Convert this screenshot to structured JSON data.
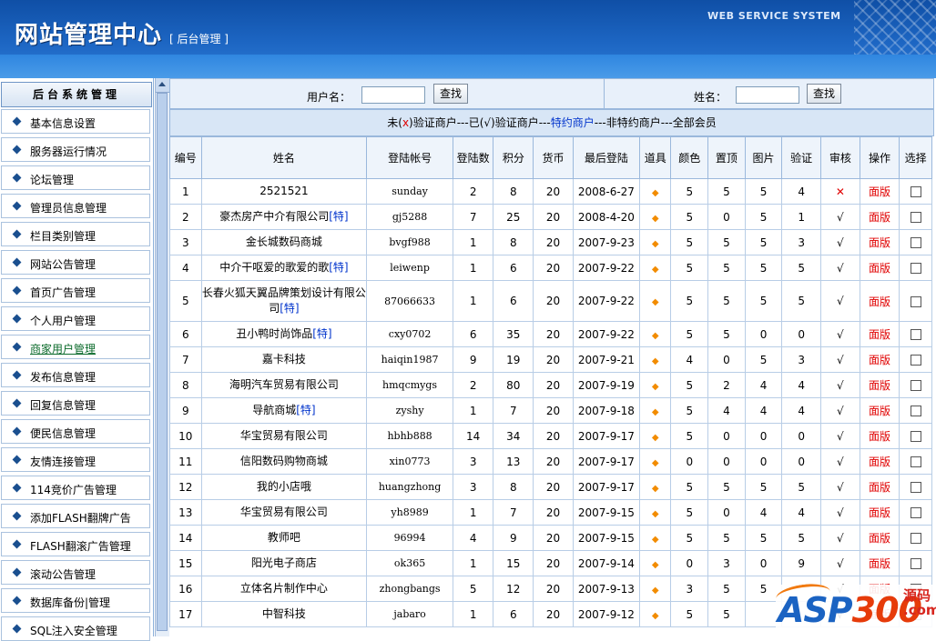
{
  "header": {
    "title": "网站管理中心",
    "subtitle": "[ 后台管理 ]",
    "system_label": "WEB SERVICE SYSTEM"
  },
  "sidebar": {
    "title": "后台系统管理",
    "items": [
      {
        "label": "基本信息设置"
      },
      {
        "label": "服务器运行情况"
      },
      {
        "label": "论坛管理"
      },
      {
        "label": "管理员信息管理"
      },
      {
        "label": "栏目类别管理"
      },
      {
        "label": "网站公告管理"
      },
      {
        "label": "首页广告管理"
      },
      {
        "label": "个人用户管理"
      },
      {
        "label": "商家用户管理"
      },
      {
        "label": "发布信息管理"
      },
      {
        "label": "回复信息管理"
      },
      {
        "label": "便民信息管理"
      },
      {
        "label": "友情连接管理"
      },
      {
        "label": "114竞价广告管理"
      },
      {
        "label": "添加FLASH翻牌广告"
      },
      {
        "label": "FLASH翻滚广告管理"
      },
      {
        "label": "滚动公告管理"
      },
      {
        "label": "数据库备份|管理"
      },
      {
        "label": "SQL注入安全管理"
      }
    ]
  },
  "search": {
    "username_label": "用户名：",
    "username_value": "",
    "button": "查找",
    "name_label": "姓名：",
    "name_value": ""
  },
  "filter": {
    "unverified_prefix": "未(",
    "x_mark": "x",
    "unverified_suffix": ")验证商户---已(√)验证商户---",
    "contract": "特约商户",
    "rest": "---非特约商户---全部会员"
  },
  "table": {
    "headers": [
      "编号",
      "姓名",
      "登陆帐号",
      "登陆数",
      "积分",
      "货币",
      "最后登陆",
      "道具",
      "颜色",
      "置顶",
      "图片",
      "验证",
      "审核",
      "操作",
      "选择"
    ],
    "special_tag": "[特]",
    "edit_label": "面版",
    "approved_mark": "√",
    "rejected_mark": "✕",
    "prop_icon": "◆",
    "rows": [
      {
        "id": "1",
        "name": "2521521",
        "special": false,
        "account": "sunday",
        "logins": "2",
        "points": "8",
        "coins": "20",
        "last": "2008-6-27",
        "color": "5",
        "top": "5",
        "pic": "5",
        "verify": "4",
        "approved": false
      },
      {
        "id": "2",
        "name": "豪杰房产中介有限公司",
        "special": true,
        "account": "gj5288",
        "logins": "7",
        "points": "25",
        "coins": "20",
        "last": "2008-4-20",
        "color": "5",
        "top": "0",
        "pic": "5",
        "verify": "1",
        "approved": true
      },
      {
        "id": "3",
        "name": "金长城数码商城",
        "special": false,
        "account": "bvgf988",
        "logins": "1",
        "points": "8",
        "coins": "20",
        "last": "2007-9-23",
        "color": "5",
        "top": "5",
        "pic": "5",
        "verify": "3",
        "approved": true
      },
      {
        "id": "4",
        "name": "中介干呕爱的歌爱的歌",
        "special": true,
        "account": "leiwenp",
        "logins": "1",
        "points": "6",
        "coins": "20",
        "last": "2007-9-22",
        "color": "5",
        "top": "5",
        "pic": "5",
        "verify": "5",
        "approved": true
      },
      {
        "id": "5",
        "name": "长春火狐天翼品牌策划设计有限公司",
        "special": true,
        "account": "87066633",
        "logins": "1",
        "points": "6",
        "coins": "20",
        "last": "2007-9-22",
        "color": "5",
        "top": "5",
        "pic": "5",
        "verify": "5",
        "approved": true,
        "tall": true
      },
      {
        "id": "6",
        "name": "丑小鸭时尚饰品",
        "special": true,
        "account": "cxy0702",
        "logins": "6",
        "points": "35",
        "coins": "20",
        "last": "2007-9-22",
        "color": "5",
        "top": "5",
        "pic": "0",
        "verify": "0",
        "approved": true
      },
      {
        "id": "7",
        "name": "嘉卡科技",
        "special": false,
        "account": "haiqin1987",
        "logins": "9",
        "points": "19",
        "coins": "20",
        "last": "2007-9-21",
        "color": "4",
        "top": "0",
        "pic": "5",
        "verify": "3",
        "approved": true
      },
      {
        "id": "8",
        "name": "海明汽车贸易有限公司",
        "special": false,
        "account": "hmqcmygs",
        "logins": "2",
        "points": "80",
        "coins": "20",
        "last": "2007-9-19",
        "color": "5",
        "top": "2",
        "pic": "4",
        "verify": "4",
        "approved": true
      },
      {
        "id": "9",
        "name": "导航商城",
        "special": true,
        "account": "zyshy",
        "logins": "1",
        "points": "7",
        "coins": "20",
        "last": "2007-9-18",
        "color": "5",
        "top": "4",
        "pic": "4",
        "verify": "4",
        "approved": true
      },
      {
        "id": "10",
        "name": "华宝贸易有限公司",
        "special": false,
        "account": "hbhb888",
        "logins": "14",
        "points": "34",
        "coins": "20",
        "last": "2007-9-17",
        "color": "5",
        "top": "0",
        "pic": "0",
        "verify": "0",
        "approved": true
      },
      {
        "id": "11",
        "name": "信阳数码购物商城",
        "special": false,
        "account": "xin0773",
        "logins": "3",
        "points": "13",
        "coins": "20",
        "last": "2007-9-17",
        "color": "0",
        "top": "0",
        "pic": "0",
        "verify": "0",
        "approved": true
      },
      {
        "id": "12",
        "name": "我的小店哦",
        "special": false,
        "account": "huangzhong",
        "logins": "3",
        "points": "8",
        "coins": "20",
        "last": "2007-9-17",
        "color": "5",
        "top": "5",
        "pic": "5",
        "verify": "5",
        "approved": true
      },
      {
        "id": "13",
        "name": "华宝贸易有限公司",
        "special": false,
        "account": "yh8989",
        "logins": "1",
        "points": "7",
        "coins": "20",
        "last": "2007-9-15",
        "color": "5",
        "top": "0",
        "pic": "4",
        "verify": "4",
        "approved": true
      },
      {
        "id": "14",
        "name": "教师吧",
        "special": false,
        "account": "96994",
        "logins": "4",
        "points": "9",
        "coins": "20",
        "last": "2007-9-15",
        "color": "5",
        "top": "5",
        "pic": "5",
        "verify": "5",
        "approved": true
      },
      {
        "id": "15",
        "name": "阳光电子商店",
        "special": false,
        "account": "ok365",
        "logins": "1",
        "points": "15",
        "coins": "20",
        "last": "2007-9-14",
        "color": "0",
        "top": "3",
        "pic": "0",
        "verify": "9",
        "approved": true
      },
      {
        "id": "16",
        "name": "立体名片制作中心",
        "special": false,
        "account": "zhongbangs",
        "logins": "5",
        "points": "12",
        "coins": "20",
        "last": "2007-9-13",
        "color": "3",
        "top": "5",
        "pic": "5",
        "verify": "",
        "approved": true
      },
      {
        "id": "17",
        "name": "中智科技",
        "special": false,
        "account": "jabaro",
        "logins": "1",
        "points": "6",
        "coins": "20",
        "last": "2007-9-12",
        "color": "5",
        "top": "5",
        "pic": "",
        "verify": "",
        "approved": true
      }
    ]
  },
  "watermark": {
    "brand_prefix": "ASP",
    "brand_number": "300",
    "tag_line1": "源码",
    "tag_line2": ".com"
  },
  "colors": {
    "header_blue": "#1d66c3",
    "accent_red": "#e00000",
    "link_blue": "#0033cc",
    "prop_orange": "#f28c00"
  }
}
